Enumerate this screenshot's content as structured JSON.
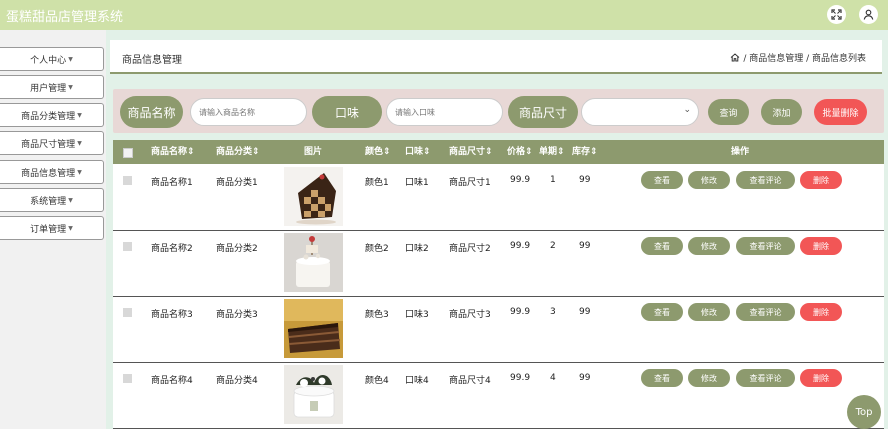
{
  "header": {
    "title": "蛋糕甜品店管理系统",
    "expand_icon": "expand-icon",
    "user_icon": "user-icon"
  },
  "sidebar": {
    "items": [
      {
        "label": "个人中心"
      },
      {
        "label": "用户管理"
      },
      {
        "label": "商品分类管理"
      },
      {
        "label": "商品尺寸管理"
      },
      {
        "label": "商品信息管理"
      },
      {
        "label": "系统管理"
      },
      {
        "label": "订单管理"
      }
    ]
  },
  "breadcrumb": {
    "title": "商品信息管理",
    "home_icon": "home-icon",
    "path": "/ 商品信息管理 / 商品信息列表"
  },
  "search": {
    "name_label": "商品名称",
    "name_placeholder": "请输入商品名称",
    "flavor_label": "口味",
    "flavor_placeholder": "请输入口味",
    "size_label": "商品尺寸",
    "size_value": "",
    "query_label": "查询",
    "add_label": "添加",
    "batch_delete_label": "批量删除"
  },
  "table": {
    "headers": [
      "商品名称",
      "商品分类",
      "图片",
      "颜色",
      "口味",
      "商品尺寸",
      "价格",
      "单期",
      "库存",
      "操作"
    ],
    "rows": [
      {
        "name": "商品名称1",
        "category": "商品分类1",
        "color": "颜色1",
        "flavor": "口味1",
        "size": "商品尺寸1",
        "price": "99.9",
        "period": "1",
        "stock": "99"
      },
      {
        "name": "商品名称2",
        "category": "商品分类2",
        "color": "颜色2",
        "flavor": "口味2",
        "size": "商品尺寸2",
        "price": "99.9",
        "period": "2",
        "stock": "99"
      },
      {
        "name": "商品名称3",
        "category": "商品分类3",
        "color": "颜色3",
        "flavor": "口味3",
        "size": "商品尺寸3",
        "price": "99.9",
        "period": "3",
        "stock": "99"
      },
      {
        "name": "商品名称4",
        "category": "商品分类4",
        "color": "颜色4",
        "flavor": "口味4",
        "size": "商品尺寸4",
        "price": "99.9",
        "period": "4",
        "stock": "99"
      }
    ],
    "actions": {
      "view": "查看",
      "edit": "修改",
      "comments": "查看评论",
      "delete": "删除"
    }
  },
  "back_to_top": "Top",
  "colors": {
    "accent": "#8d9a6e",
    "danger": "#f25656",
    "header_bg": "#cfe1a8",
    "search_bg": "#e8d8d6"
  }
}
